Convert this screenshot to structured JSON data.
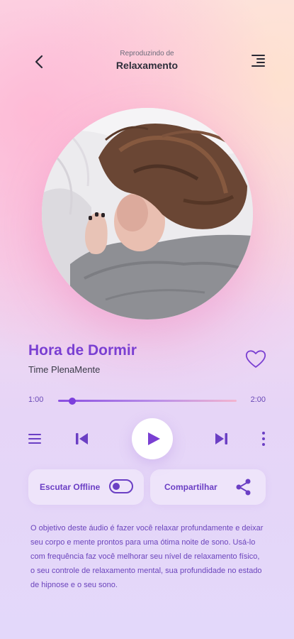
{
  "header": {
    "subtitle": "Reproduzindo de",
    "title": "Relaxamento"
  },
  "track": {
    "title": "Hora de Dormir",
    "artist": "Time PlenaMente",
    "liked": false
  },
  "progress": {
    "current": "1:00",
    "duration": "2:00",
    "fraction": 0.08
  },
  "actions": {
    "offline_label": "Escutar Offline",
    "offline_enabled": false,
    "share_label": "Compartilhar"
  },
  "description": "O objetivo deste áudio é fazer você relaxar profundamente e deixar seu corpo e mente prontos para uma ótima noite de sono. Usá-lo com frequência faz você melhorar seu nível de relaxamento físico, o seu controle de relaxamento mental, sua profundidade no estado de hipnose e o seu sono.",
  "colors": {
    "accent": "#7a3fd2",
    "accent_dark": "#6b3fc4"
  }
}
